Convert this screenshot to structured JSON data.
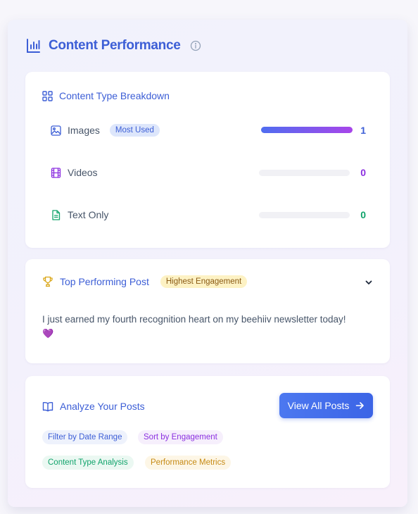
{
  "header": {
    "title": "Content Performance",
    "title_icon": "bar-chart-icon",
    "info_icon": "info-icon"
  },
  "breakdown": {
    "title": "Content Type Breakdown",
    "icon": "grid-icon",
    "rows": [
      {
        "label": "Images",
        "badge": "Most Used",
        "count": "1",
        "fill_fraction": 1.0,
        "color": "#4f6df0",
        "icon": "image-icon"
      },
      {
        "label": "Videos",
        "count": "0",
        "fill_fraction": 0,
        "color": "#8b2fe0",
        "icon": "film-icon"
      },
      {
        "label": "Text Only",
        "count": "0",
        "fill_fraction": 0,
        "color": "#10a36b",
        "icon": "document-icon"
      }
    ]
  },
  "top_post": {
    "title": "Top Performing Post",
    "badge": "Highest Engagement",
    "icon": "trophy-icon",
    "text": "I just earned my fourth recognition heart on my beehiiv newsletter today!",
    "emoji": "💜"
  },
  "analyze": {
    "title": "Analyze Your Posts",
    "icon": "book-icon",
    "button_label": "View All Posts",
    "tags": [
      {
        "label": "Filter by Date Range",
        "color": "#3c5ed6",
        "bg": "#eef2fc"
      },
      {
        "label": "Sort by Engagement",
        "color": "#8b2fe0",
        "bg": "#f6effc"
      },
      {
        "label": "Content Type Analysis",
        "color": "#10a36b",
        "bg": "#ebf8f2"
      },
      {
        "label": "Performance Metrics",
        "color": "#c68a14",
        "bg": "#fdf6e6"
      }
    ]
  },
  "colors": {
    "accent": "#3c5ed6",
    "purple": "#8b2fe0",
    "green": "#10a36b",
    "gold": "#d9a514"
  }
}
